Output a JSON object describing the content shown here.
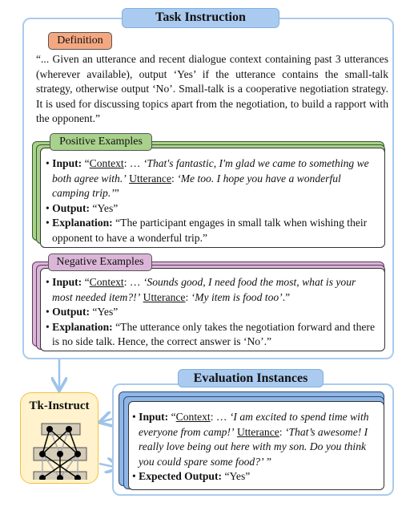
{
  "task_instruction": {
    "title": "Task Instruction"
  },
  "definition": {
    "label": "Definition",
    "text": "“... Given an utterance and recent dialogue context containing past 3 utterances (wherever available), output ‘Yes’ if the utterance contains the small-talk strategy, otherwise output ‘No’. Small-talk is a cooperative negotiation strategy. It is used for discussing topics apart from the negotiation, to build a rapport with the opponent.”"
  },
  "positive": {
    "label": "Positive Examples",
    "input_label": "Input:",
    "q_open": "“",
    "context_label": "Context",
    "context_text": ": … ",
    "context_quote": "‘That's fantastic, I'm glad we came to something we both agree with.’",
    "utterance_label": "Utterance",
    "utterance_text": "‘Me too. I hope you have a wonderful camping trip.’",
    "q_close": "”",
    "output_label": "Output:",
    "output_value": "“Yes”",
    "explanation_label": "Explanation:",
    "explanation": "“The participant engages in small talk when wishing their opponent to have a wonderful trip.”"
  },
  "negative": {
    "label": "Negative Examples",
    "input_label": "Input:",
    "q_open": "“",
    "context_label": "Context",
    "context_text": ": … ",
    "context_quote": "‘Sounds good, I need food the most, what is your most needed item?!’",
    "utterance_label": "Utterance",
    "utterance_text": "‘My item is food too’",
    "q_close": ".”",
    "output_label": "Output:",
    "output_value": "“Yes”",
    "explanation_label": "Explanation:",
    "explanation": "“The utterance only takes the negotiation forward and there is no side talk. Hence, the correct answer is ‘No’.”"
  },
  "model": {
    "name": "Tk-Instruct"
  },
  "evaluation": {
    "title": "Evaluation Instances",
    "input_label": "Input:",
    "q_open": "“",
    "context_label": "Context",
    "context_text": ": … ",
    "context_quote": "‘I am excited to spend time with everyone from camp!’",
    "utterance_label": "Utterance",
    "utterance_text": "‘That’s awesome! I really love being out here with my son. Do you think you could spare some food?’",
    "q_close": " ”",
    "output_label": "Expected Output:",
    "output_value": "“Yes”"
  },
  "colors": {
    "blue": "#aacbef",
    "orange": "#f4a882",
    "green": "#a8d18c",
    "pink": "#dbb6d8",
    "yellow": "#fff2cc"
  }
}
